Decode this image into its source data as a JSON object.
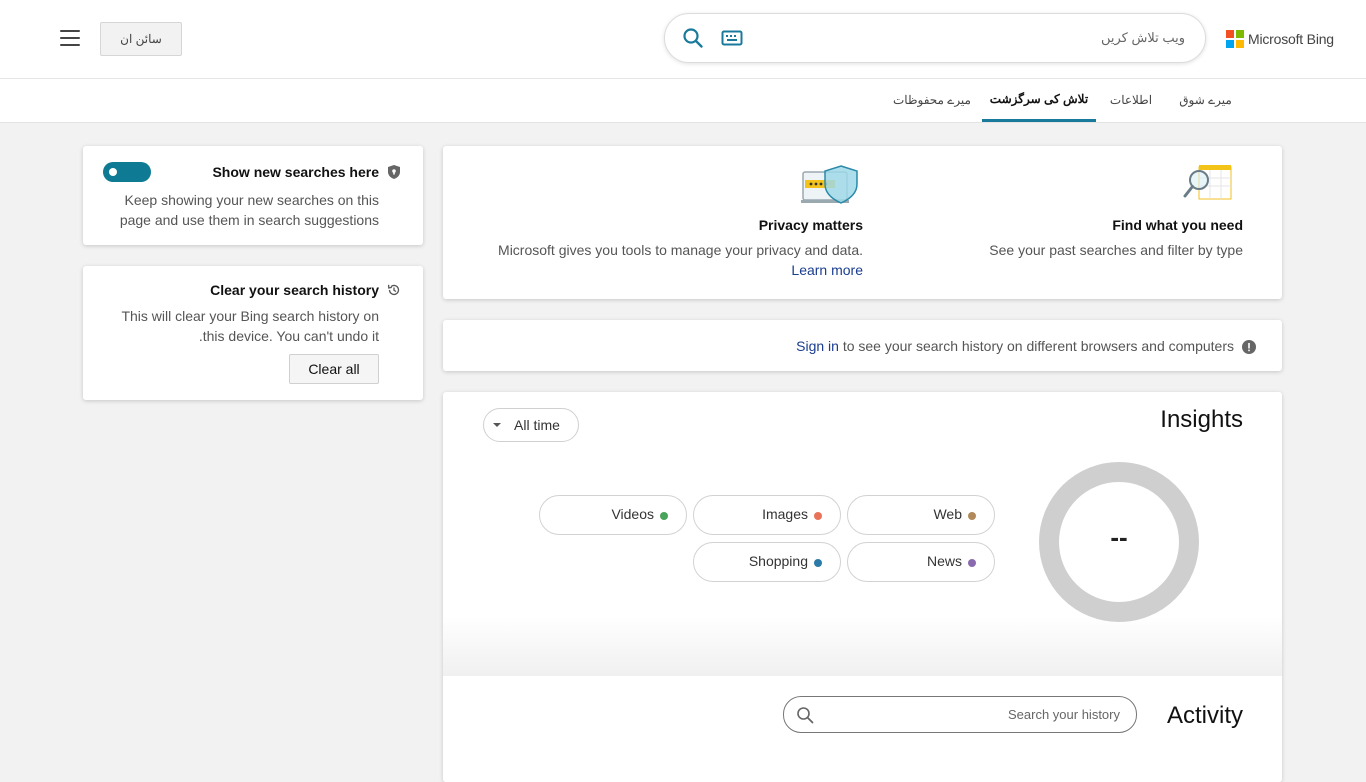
{
  "header": {
    "signin_label": "سائن ان",
    "search_placeholder": "ویب تلاش کریں",
    "logo_text": "Microsoft Bing"
  },
  "tabs": [
    {
      "label": "میرے شوق"
    },
    {
      "label": "اطلاعات"
    },
    {
      "label": "تلاش کی سرگزشت"
    },
    {
      "label": "میرے محفوظات"
    }
  ],
  "active_tab": "تلاش کی سرگزشت",
  "find_card": {
    "title": "Find what you need",
    "text": "See your past searches and filter by type"
  },
  "privacy_card": {
    "title": "Privacy matters",
    "text": "Microsoft gives you tools to manage your privacy and data.",
    "link": "Learn more"
  },
  "signin_card": {
    "link": "Sign in",
    "text": "to see your search history on different browsers and computers"
  },
  "insights": {
    "title": "Insights",
    "filter": "All time",
    "total": "--",
    "categories": [
      {
        "label": "Web",
        "color": "#b08a5a"
      },
      {
        "label": "Images",
        "color": "#e8735a"
      },
      {
        "label": "Videos",
        "color": "#4aa35a"
      },
      {
        "label": "News",
        "color": "#8a6aae"
      },
      {
        "label": "Shopping",
        "color": "#2b7aa8"
      }
    ]
  },
  "activity": {
    "title": "Activity",
    "search_placeholder": "Search your history"
  },
  "show_searches_card": {
    "title": "Show new searches here",
    "text": "Keep showing your new searches on this page and use them in search suggestions",
    "toggle_on": true
  },
  "clear_card": {
    "title": "Clear your search history",
    "text": "This will clear your Bing search history on this device. You can't undo it.",
    "button": "Clear all"
  },
  "colors": {
    "accent": "#0e7a93",
    "link": "#1a3d8f",
    "logo": [
      "#f25022",
      "#7fba00",
      "#00a4ef",
      "#ffb900"
    ]
  }
}
